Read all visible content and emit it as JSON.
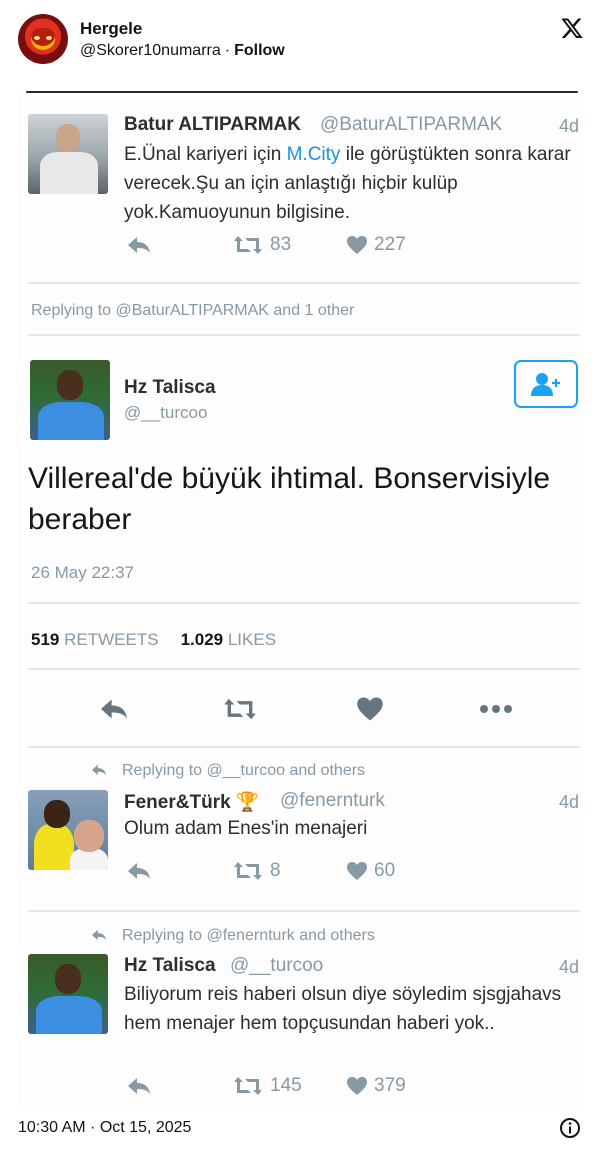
{
  "embed": {
    "display_name": "Hergele",
    "handle": "@Skorer10numarra",
    "separator": "·",
    "follow_label": "Follow",
    "timestamp": "10:30 AM · Oct 15, 2025",
    "logo_icon": "x-logo-icon",
    "info_icon": "info-icon"
  },
  "screenshot": {
    "tweet1": {
      "name": "Batur ALTIPARMAK",
      "handle": "@BaturALTIPARMAK",
      "time": "4d",
      "text_before_link": "E.Ünal kariyeri için ",
      "link": "M.City",
      "text_after_link": " ile görüştükten sonra karar verecek.Şu an için anlaştığı hiçbir kulüp yok.Kamuoyunun bilgisine.",
      "retweets": "83",
      "likes": "227"
    },
    "main_reply_context": "Replying to @BaturALTIPARMAK and 1 other",
    "main_tweet": {
      "name": "Hz Talisca",
      "handle": "@__turcoo",
      "text": "Villereal'de büyük ihtimal. Bonservisiyle beraber",
      "timestamp": "26 May 22:37",
      "retweets_count": "519",
      "retweets_label": "RETWEETS",
      "likes_count": "1.029",
      "likes_label": "LIKES"
    },
    "reply1": {
      "context": "Replying to @__turcoo and others",
      "name": "Fener&Türk",
      "name_emoji": "🏆",
      "handle": "@fenernturk",
      "time": "4d",
      "text": "Olum adam Enes'in menajeri",
      "retweets": "8",
      "likes": "60"
    },
    "reply2": {
      "context": "Replying to @fenernturk and others",
      "name": "Hz Talisca",
      "handle": "@__turcoo",
      "time": "4d",
      "text": "Biliyorum reis haberi olsun diye söyledim sjsgjahavs hem menajer hem topçusundan haberi yok..",
      "retweets": "145",
      "likes": "379"
    }
  },
  "colors": {
    "link_blue": "#1b95e0",
    "muted_gray": "#8899a6",
    "follow_blue": "#1da1f2"
  }
}
